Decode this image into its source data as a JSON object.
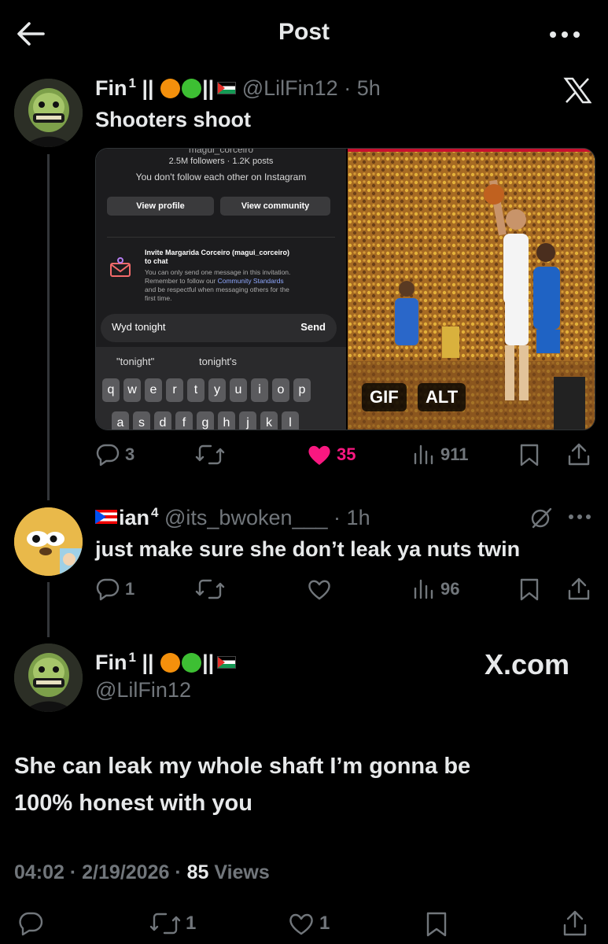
{
  "header": {
    "title": "Post"
  },
  "post1": {
    "name": "Fin",
    "superscript": "1",
    "separator": "||",
    "handle": "@LilFin12",
    "time": "5h",
    "text": "Shooters shoot",
    "media": {
      "instagram": {
        "top_cut": "magui_corceiro",
        "stats": "2.5M followers · 1.2K posts",
        "follow_note": "You don't follow each other on Instagram",
        "view_profile": "View profile",
        "view_community": "View community",
        "invite_title": "Invite Margarida Corceiro (magui_corceiro)",
        "invite_title2": "to chat",
        "invite_line1": "You can only send one message in this invitation.",
        "invite_line2a": "Remember to follow our ",
        "invite_line2b": "Community Standards",
        "invite_line3": "and be respectful when messaging others for the",
        "invite_line4": "first time.",
        "message": "Wyd tonight",
        "send": "Send",
        "suggest1": "\"tonight\"",
        "suggest2": "tonight's",
        "keys_row1": [
          "q",
          "w",
          "e",
          "r",
          "t",
          "y",
          "u",
          "i",
          "o",
          "p"
        ],
        "keys_row2": [
          "a",
          "s",
          "d",
          "f",
          "g",
          "h",
          "j",
          "k",
          "l"
        ]
      },
      "gif_badge": "GIF",
      "alt_badge": "ALT"
    },
    "replies": "3",
    "likes": "35",
    "views": "911",
    "like_color": "#f91880"
  },
  "post2": {
    "name": "ian",
    "superscript": "4",
    "handle": "@its_bwoken___",
    "time": "1h",
    "text": "just make sure she don’t leak ya nuts twin",
    "replies": "1",
    "views": "96"
  },
  "post3": {
    "name": "Fin",
    "superscript": "1",
    "separator": "||",
    "handle": "@LilFin12",
    "watermark": "X.com",
    "text_line1": "She can leak my whole shaft I’m gonna be",
    "text_line2": "100% honest with you",
    "timestamp": "04:02 · 2/19/2026 · ",
    "views_count": "85",
    "views_label": " Views",
    "reposts": "1",
    "likes": "1"
  },
  "colors": {
    "background": "#000000",
    "text": "#e7e9ea",
    "muted": "#71767b",
    "orange_dot": "#f4900c",
    "green_dot": "#3dbf33"
  },
  "icons": [
    "back-arrow-icon",
    "more-icon",
    "x-logo-icon",
    "reply-icon",
    "repost-icon",
    "like-icon",
    "views-icon",
    "bookmark-icon",
    "share-icon",
    "grok-icon"
  ]
}
